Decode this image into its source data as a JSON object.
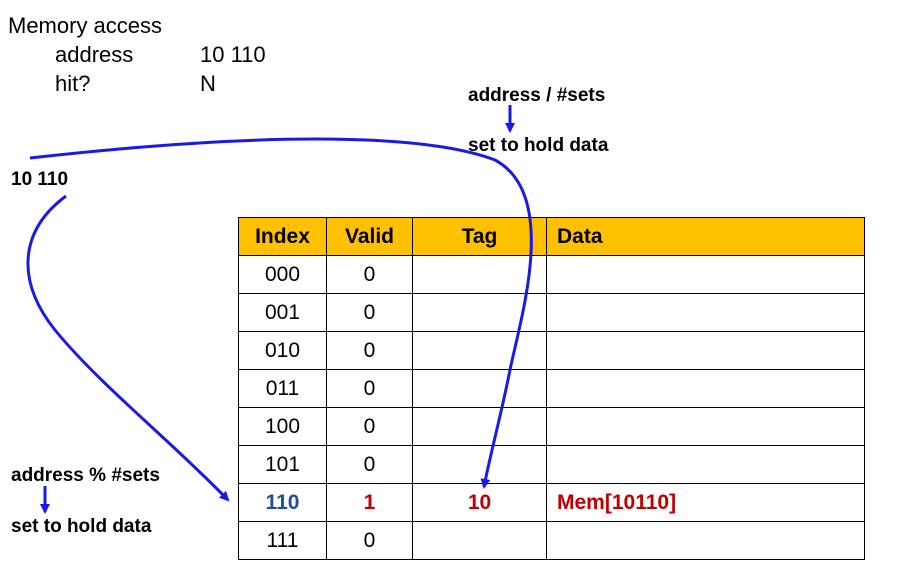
{
  "memory_access": {
    "title": "Memory access",
    "address_label": "address",
    "address_value": "10 110",
    "hit_label": "hit?",
    "hit_value": "N"
  },
  "address_bits": "10 110",
  "tag_note": {
    "line1": "address / #sets",
    "line2": "set to hold data"
  },
  "index_note": {
    "line1": "address % #sets",
    "line2": "set to hold data"
  },
  "table": {
    "headers": [
      "Index",
      "Valid",
      "Tag",
      "Data"
    ],
    "rows": [
      {
        "index": "000",
        "valid": "0",
        "tag": "",
        "data": ""
      },
      {
        "index": "001",
        "valid": "0",
        "tag": "",
        "data": ""
      },
      {
        "index": "010",
        "valid": "0",
        "tag": "",
        "data": ""
      },
      {
        "index": "011",
        "valid": "0",
        "tag": "",
        "data": ""
      },
      {
        "index": "100",
        "valid": "0",
        "tag": "",
        "data": ""
      },
      {
        "index": "101",
        "valid": "0",
        "tag": "",
        "data": ""
      },
      {
        "index": "110",
        "valid": "1",
        "tag": "10",
        "data": "Mem[10110]"
      },
      {
        "index": "111",
        "valid": "0",
        "tag": "",
        "data": ""
      }
    ]
  },
  "colors": {
    "header_bg": "#ffc000",
    "arrow": "#1a1ae6",
    "index_highlight": "#1f4e9a",
    "entry_highlight": "#c00000"
  }
}
